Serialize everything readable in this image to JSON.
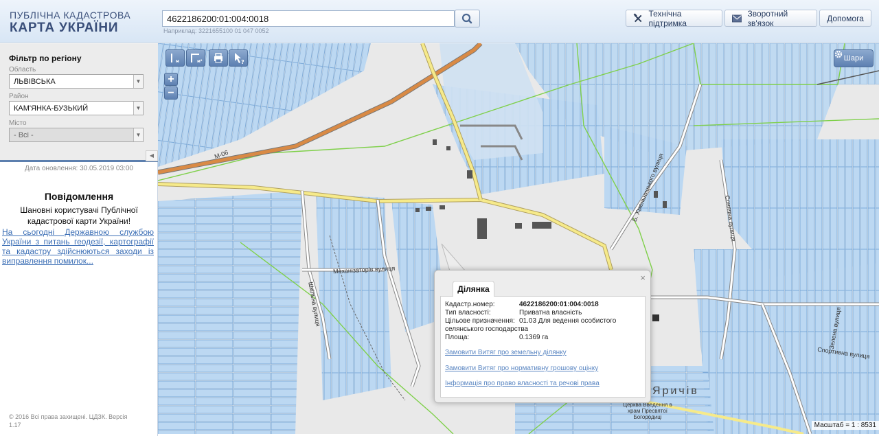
{
  "header": {
    "logo_line1": "ПУБЛІЧНА КАДАСТРОВА",
    "logo_line2": "КАРТА УКРАЇНИ",
    "search_value": "4622186200:01:004:0018",
    "search_hint": "Наприклад: 3221655100 01 047 0052",
    "support_label": "Технічна підтримка",
    "feedback_label": "Зворотний зв'язок",
    "help_label": "Допомога"
  },
  "filter": {
    "title": "Фільтр по регіону",
    "region_label": "Область",
    "region_value": "ЛЬВІВСЬКА",
    "district_label": "Район",
    "district_value": "КАМ'ЯНКА-БУЗЬКИЙ",
    "city_label": "Місто",
    "city_value": "- Всі -"
  },
  "sidebar": {
    "update_date": "Дата оновлення: 30.05.2019 03:00",
    "message_title": "Повідомлення",
    "message_greeting": "Шановні користувачі Публічної кадастрової карти України!",
    "message_link": "На сьогодні Державною службою України з питань геодезії, картографії та кадастру здійснюються заходи із виправлення помилок...",
    "copyright": "© 2016 Всі права захищені. ЦДЗК. Версія 1.17"
  },
  "map": {
    "layers_label": "Шари",
    "scale_text": "Масштаб = 1 : 8531",
    "road_label_m06": "М-06",
    "street_mechanizatoriv": "Механізаторів вулиця",
    "street_b_khmelnytskoho": "Б. Хмельницького вулиця",
    "street_sonyachna": "Сонячна вулиця",
    "street_zelena": "Зелена вулиця",
    "street_sportyvna": "Спортивна вулиця",
    "street_shkilna": "Шкільна вулиця",
    "village_label": "Яричів",
    "church_label": "Церква Введення в храм Пресвятої Богородиці"
  },
  "popup": {
    "tab_label": "Ділянка",
    "close": "×",
    "cad_num_label": "Кадастр.номер:",
    "cad_num_value": "4622186200:01:004:0018",
    "ownership_label": "Тип власності:",
    "ownership_value": "Приватна власність",
    "purpose_label": "Цільове призначення:",
    "purpose_value": "01.03 Для ведення особистого селянського господарства",
    "area_label": "Площа:",
    "area_value": "0.1369 га",
    "link_extract_land": "Замовити Витяг про земельну ділянку",
    "link_extract_valuation": "Замовити Витяг про нормативну грошову оцінку",
    "link_rights_info": "Інформація про право власності та речові права"
  }
}
